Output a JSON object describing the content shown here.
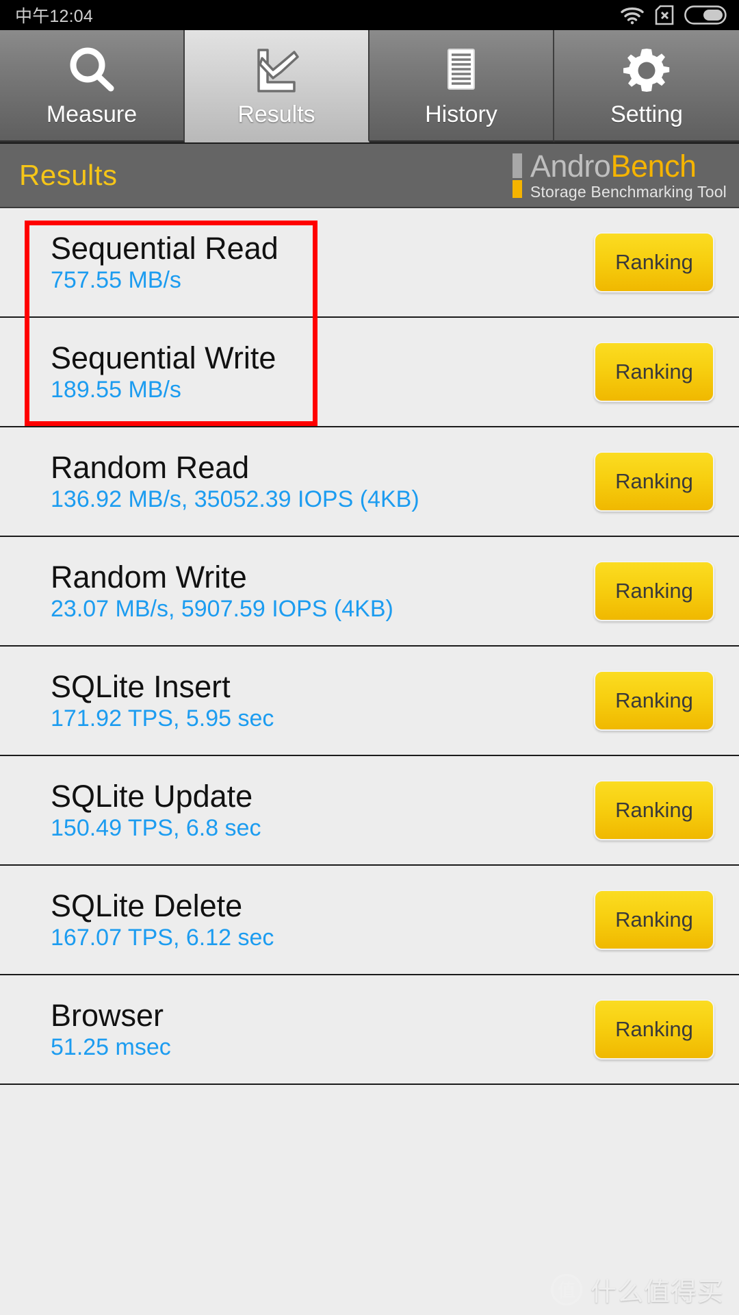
{
  "statusbar": {
    "clock": "中午12:04",
    "icons": [
      "wifi-icon",
      "sim-card-off-icon",
      "battery-icon"
    ]
  },
  "tabs": [
    {
      "label": "Measure",
      "icon": "magnifier-icon",
      "active": false
    },
    {
      "label": "Results",
      "icon": "line-chart-icon",
      "active": true
    },
    {
      "label": "History",
      "icon": "document-lines-icon",
      "active": false
    },
    {
      "label": "Setting",
      "icon": "gear-icon",
      "active": false
    }
  ],
  "header": {
    "title": "Results",
    "brand_part1": "Andro",
    "brand_part2": "Bench",
    "brand_subtitle": "Storage Benchmarking Tool"
  },
  "colors": {
    "accent_yellow": "#f5b400",
    "title_yellow": "#f5c518",
    "value_blue": "#1c9cf0",
    "annotation_red": "#ff0000",
    "list_bg": "#ededed",
    "header_gray": "#656565"
  },
  "results": {
    "ranking_label": "Ranking",
    "rows": [
      {
        "name": "Sequential Read",
        "value": "757.55 MB/s"
      },
      {
        "name": "Sequential Write",
        "value": "189.55 MB/s"
      },
      {
        "name": "Random Read",
        "value": "136.92 MB/s, 35052.39 IOPS (4KB)"
      },
      {
        "name": "Random Write",
        "value": "23.07 MB/s, 5907.59 IOPS (4KB)"
      },
      {
        "name": "SQLite Insert",
        "value": "171.92 TPS, 5.95 sec"
      },
      {
        "name": "SQLite Update",
        "value": "150.49 TPS, 6.8 sec"
      },
      {
        "name": "SQLite Delete",
        "value": "167.07 TPS, 6.12 sec"
      },
      {
        "name": "Browser",
        "value": "51.25 msec"
      }
    ]
  },
  "watermark": {
    "badge": "值",
    "text": "什么值得买"
  }
}
